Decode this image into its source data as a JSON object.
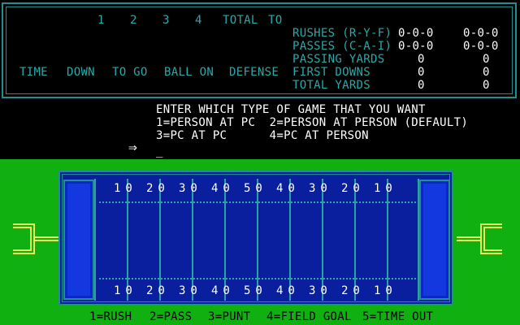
{
  "scoreboard": {
    "quarters": [
      "1",
      "2",
      "3",
      "4"
    ],
    "total_label": "TOTAL",
    "to_label": "TO",
    "situation_headers": [
      "TIME",
      "DOWN",
      "TO GO",
      "BALL ON",
      "DEFENSE"
    ],
    "stats": [
      {
        "label": "RUSHES (R-Y-F)",
        "team1": "0-0-0",
        "team2": "0-0-0"
      },
      {
        "label": "PASSES (C-A-I)",
        "team1": "0-0-0",
        "team2": "0-0-0"
      },
      {
        "label": "PASSING YARDS",
        "team1": "0",
        "team2": "0"
      },
      {
        "label": "FIRST DOWNS",
        "team1": "0",
        "team2": "0"
      },
      {
        "label": "TOTAL YARDS",
        "team1": "0",
        "team2": "0"
      }
    ]
  },
  "prompt": {
    "line1": "ENTER WHICH TYPE OF GAME THAT YOU WANT",
    "line2": "1=PERSON AT PC  2=PERSON AT PERSON (DEFAULT)",
    "line3": "3=PC AT PC      4=PC AT PERSON",
    "arrow": "⇒",
    "cursor": "_"
  },
  "field": {
    "yard_numbers": [
      "10",
      "20",
      "30",
      "40",
      "50",
      "40",
      "30",
      "20",
      "10"
    ]
  },
  "menu": {
    "items": [
      "1=RUSH",
      "2=PASS",
      "3=PUNT",
      "4=FIELD GOAL",
      "5=TIME OUT"
    ]
  },
  "colors": {
    "cyan": "#27a9a9",
    "field_green": "#10b010",
    "field_blue": "#0a1f9e",
    "endzone_blue": "#1438e0",
    "goalpost_yellow": "#f0f060"
  }
}
